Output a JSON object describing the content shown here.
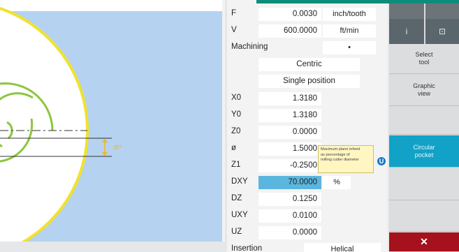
{
  "graphic": {
    "dimension_label": "Ø?",
    "colors": {
      "background": "#b5d2f0",
      "outer_circle": "#f2e22a",
      "spiral": "#8cc63f"
    }
  },
  "params": {
    "rows": [
      {
        "label": "F",
        "value": "0.0030",
        "unit": "inch/tooth"
      },
      {
        "label": "V",
        "value": "600.0000",
        "unit": "ft/min"
      },
      {
        "label": "Machining",
        "value": "",
        "unit": "•"
      },
      {
        "label": "",
        "value": "Centric",
        "unit": ""
      },
      {
        "label": "",
        "value": "Single position",
        "unit": ""
      },
      {
        "label": "X0",
        "value": "1.3180",
        "unit": ""
      },
      {
        "label": "Y0",
        "value": "1.3180",
        "unit": ""
      },
      {
        "label": "Z0",
        "value": "0.0000",
        "unit": ""
      },
      {
        "label": "ø",
        "value": "1.5000",
        "unit": ""
      },
      {
        "label": "Z1",
        "value": "-0.2500",
        "unit": ""
      },
      {
        "label": "DXY",
        "value": "70.0000",
        "unit": "%"
      },
      {
        "label": "DZ",
        "value": "0.1250",
        "unit": ""
      },
      {
        "label": "UXY",
        "value": "0.0100",
        "unit": ""
      },
      {
        "label": "UZ",
        "value": "0.0000",
        "unit": ""
      },
      {
        "label": "Insertion",
        "value": "Helical",
        "unit": ""
      }
    ]
  },
  "tooltip": {
    "line1": "Maximum plane infeed",
    "line2": "as percentage of",
    "line3": "milling cutter diameter",
    "icon": "toggle-icon"
  },
  "softkeys": {
    "info_icon": "info-icon",
    "info_glyph": "i",
    "window_icon": "window-icon",
    "window_glyph": "⊡",
    "select_tool": "Select\ntool",
    "graphic_view": "Graphic\nview",
    "circular_pocket": "Circular\npocket",
    "cancel_glyph": "✕",
    "active_color": "#12a2c8",
    "cancel_color": "#a5111c"
  }
}
